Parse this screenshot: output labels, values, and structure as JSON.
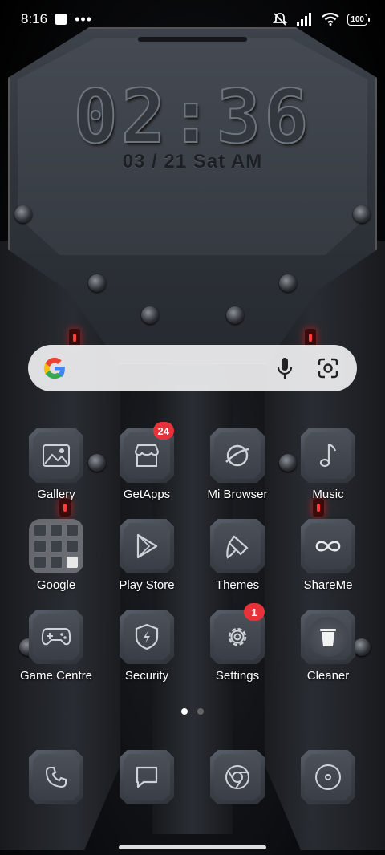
{
  "status_bar": {
    "time": "8:16",
    "more_dots": "•••",
    "battery": "100"
  },
  "clock_widget": {
    "time": "02:36",
    "date": "03 / 21 Sat AM"
  },
  "search_bar": {
    "voice_icon": "mic-icon",
    "lens_icon": "lens-icon"
  },
  "apps": {
    "row1": [
      {
        "label": "Gallery",
        "icon": "gallery-icon"
      },
      {
        "label": "GetApps",
        "icon": "store-icon",
        "badge": "24"
      },
      {
        "label": "Mi Browser",
        "icon": "browser-icon"
      },
      {
        "label": "Music",
        "icon": "music-icon"
      }
    ],
    "row2": [
      {
        "label": "Google",
        "icon": "folder-icon"
      },
      {
        "label": "Play Store",
        "icon": "play-store-icon"
      },
      {
        "label": "Themes",
        "icon": "themes-icon"
      },
      {
        "label": "ShareMe",
        "icon": "shareme-icon"
      }
    ],
    "row3": [
      {
        "label": "Game Centre",
        "icon": "gamepad-icon"
      },
      {
        "label": "Security",
        "icon": "shield-icon"
      },
      {
        "label": "Settings",
        "icon": "gear-icon",
        "badge": "1"
      },
      {
        "label": "Cleaner",
        "icon": "trash-icon"
      }
    ]
  },
  "pages": {
    "count": 2,
    "active": 1
  },
  "dock": [
    {
      "icon": "phone-icon"
    },
    {
      "icon": "messages-icon"
    },
    {
      "icon": "chrome-icon"
    },
    {
      "icon": "camera-icon"
    }
  ]
}
